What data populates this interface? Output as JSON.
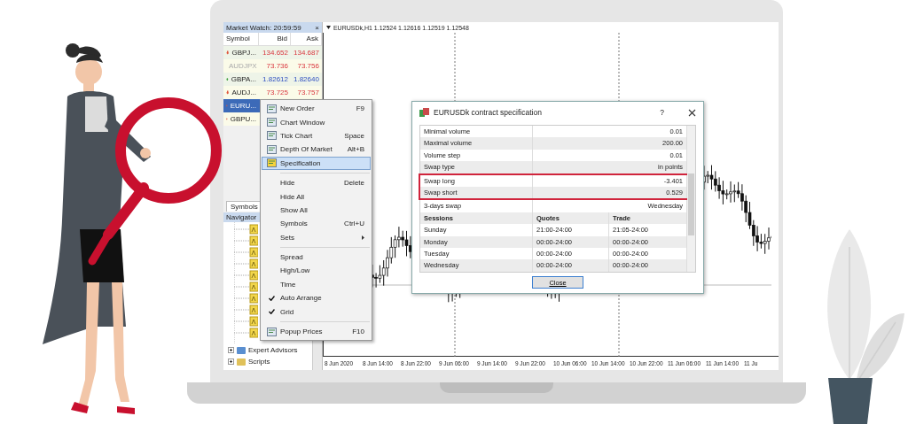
{
  "market_watch": {
    "title": "Market Watch: 20:59:59",
    "close": "×",
    "columns": [
      "Symbol",
      "Bid",
      "Ask"
    ],
    "rows": [
      {
        "symbol": "GBPJ...",
        "bid": "134.652",
        "ask": "134.687",
        "kind": "down",
        "dimmed": false,
        "selected": false
      },
      {
        "symbol": "AUDJPX",
        "bid": "73.736",
        "ask": "73.756",
        "kind": "down",
        "dimmed": true,
        "selected": false
      },
      {
        "symbol": "GBPA...",
        "bid": "1.82612",
        "ask": "1.82640",
        "kind": "up",
        "dimmed": false,
        "selected": false
      },
      {
        "symbol": "AUDJ...",
        "bid": "73.725",
        "ask": "73.757",
        "kind": "down",
        "dimmed": false,
        "selected": false
      },
      {
        "symbol": "EURU...",
        "kind": "down",
        "dimmed": false,
        "selected": true
      },
      {
        "symbol": "GBPU...",
        "kind": "down",
        "dimmed": false,
        "selected": false
      }
    ]
  },
  "symbols_tab": "Symbols",
  "navigator": {
    "title": "Navigator",
    "items": [
      {
        "label": "Expert Advisors",
        "expanded": false
      },
      {
        "label": "Scripts",
        "expanded": false
      }
    ]
  },
  "chart": {
    "header": "EURUSDk,H1  1.12524 1.12616 1.12519 1.12548",
    "time_labels": [
      "8 Jun 2020",
      "8 Jun 14:00",
      "8 Jun 22:00",
      "9 Jun 06:00",
      "9 Jun 14:00",
      "9 Jun 22:00",
      "10 Jun 06:00",
      "10 Jun 14:00",
      "10 Jun 22:00",
      "11 Jun 06:00",
      "11 Jun 14:00",
      "11 Ju"
    ]
  },
  "context_menu": {
    "items": [
      {
        "kind": "item",
        "label": "New Order",
        "shortcut": "F9",
        "icon": true,
        "checked": false,
        "selected": false,
        "submenu": false
      },
      {
        "kind": "item",
        "label": "Chart Window",
        "icon": true,
        "checked": false,
        "selected": false,
        "submenu": false
      },
      {
        "kind": "item",
        "label": "Tick Chart",
        "shortcut": "Space",
        "icon": true,
        "checked": false,
        "selected": false,
        "submenu": false
      },
      {
        "kind": "item",
        "label": "Depth Of Market",
        "shortcut": "Alt+B",
        "icon": true,
        "checked": false,
        "selected": false,
        "submenu": false
      },
      {
        "kind": "item",
        "label": "Specification",
        "icon": true,
        "checked": false,
        "selected": true,
        "submenu": false
      },
      {
        "kind": "separator"
      },
      {
        "kind": "item",
        "label": "Hide",
        "shortcut": "Delete",
        "icon": false,
        "checked": false,
        "selected": false,
        "submenu": false
      },
      {
        "kind": "item",
        "label": "Hide All",
        "icon": false,
        "checked": false,
        "selected": false,
        "submenu": false
      },
      {
        "kind": "item",
        "label": "Show All",
        "icon": false,
        "checked": false,
        "selected": false,
        "submenu": false
      },
      {
        "kind": "item",
        "label": "Symbols",
        "shortcut": "Ctrl+U",
        "icon": false,
        "checked": false,
        "selected": false,
        "submenu": false
      },
      {
        "kind": "item",
        "label": "Sets",
        "icon": false,
        "checked": false,
        "selected": false,
        "submenu": true
      },
      {
        "kind": "separator"
      },
      {
        "kind": "item",
        "label": "Spread",
        "icon": false,
        "checked": false,
        "selected": false,
        "submenu": false
      },
      {
        "kind": "item",
        "label": "High/Low",
        "icon": false,
        "checked": false,
        "selected": false,
        "submenu": false
      },
      {
        "kind": "item",
        "label": "Time",
        "icon": false,
        "checked": false,
        "selected": false,
        "submenu": false
      },
      {
        "kind": "item",
        "label": "Auto Arrange",
        "icon": false,
        "checked": true,
        "selected": false,
        "submenu": false
      },
      {
        "kind": "item",
        "label": "Grid",
        "icon": false,
        "checked": true,
        "selected": false,
        "submenu": false
      },
      {
        "kind": "separator"
      },
      {
        "kind": "item",
        "label": "Popup Prices",
        "shortcut": "F10",
        "icon": true,
        "checked": false,
        "selected": false,
        "submenu": false
      }
    ]
  },
  "dialog": {
    "title": "EURUSDk contract specification",
    "help": "?",
    "properties": [
      {
        "label": "Minimal volume",
        "value": "0.01",
        "highlighted": false
      },
      {
        "label": "Maximal volume",
        "value": "200.00",
        "highlighted": false
      },
      {
        "label": "Volume step",
        "value": "0.01",
        "highlighted": false
      },
      {
        "label": "Swap type",
        "value": "in points",
        "highlighted": false
      },
      {
        "label": "Swap long",
        "value": "-3.401",
        "highlighted": true
      },
      {
        "label": "Swap short",
        "value": "0.529",
        "highlighted": true
      },
      {
        "label": "3-days swap",
        "value": "Wednesday",
        "highlighted": false
      }
    ],
    "session_columns": [
      "Sessions",
      "Quotes",
      "Trade"
    ],
    "sessions": [
      [
        "Sunday",
        "21:00-24:00",
        "21:05-24:00"
      ],
      [
        "Monday",
        "00:00-24:00",
        "00:00-24:00"
      ],
      [
        "Tuesday",
        "00:00-24:00",
        "00:00-24:00"
      ],
      [
        "Wednesday",
        "00:00-24:00",
        "00:00-24:00"
      ]
    ],
    "button": "Close"
  }
}
